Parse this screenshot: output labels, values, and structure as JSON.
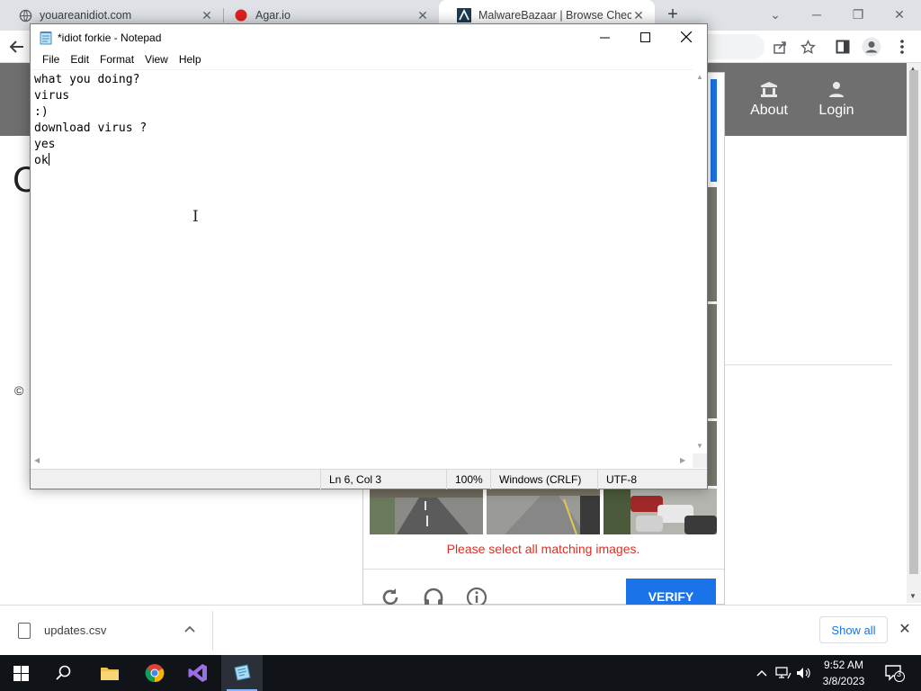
{
  "browser": {
    "tabs": [
      {
        "title": "youareanidiot.com",
        "active": false
      },
      {
        "title": "Agar.io",
        "active": false
      },
      {
        "title": "MalwareBazaar | Browse Checking",
        "active": true
      }
    ],
    "new_tab_symbol": "+",
    "window_controls": {
      "tabsearch": "⌄",
      "minimize": "─",
      "restore": "❐",
      "close": "✕"
    },
    "icons": [
      "back-icon",
      "share-icon",
      "star-icon",
      "sidepanel-icon",
      "profile-icon",
      "kebab-menu-icon"
    ]
  },
  "page": {
    "nav": [
      {
        "label": "About",
        "icon": "bank-icon"
      },
      {
        "label": "Login",
        "icon": "user-icon"
      }
    ],
    "heading_fragment": "C",
    "copyright": "©"
  },
  "captcha": {
    "error_message": "Please select all matching images.",
    "verify_label": "VERIFY",
    "icons": [
      "reload-icon",
      "headphones-icon",
      "info-icon"
    ]
  },
  "notepad": {
    "title": "*idiot forkie - Notepad",
    "menu": [
      "File",
      "Edit",
      "Format",
      "View",
      "Help"
    ],
    "lines": [
      "what you doing?",
      "virus",
      ":)",
      "download virus ?",
      "yes",
      "ok"
    ],
    "status": {
      "position": "Ln 6, Col 3",
      "zoom": "100%",
      "line_ending": "Windows (CRLF)",
      "encoding": "UTF-8"
    }
  },
  "downloads": {
    "file_name": "updates.csv",
    "show_all_label": "Show all"
  },
  "taskbar": {
    "apps": [
      "start-icon",
      "search-icon",
      "file-explorer-icon",
      "chrome-icon",
      "visual-studio-icon",
      "notepad-icon"
    ],
    "time": "9:52 AM",
    "date": "3/8/2023",
    "notification_count": "3"
  }
}
